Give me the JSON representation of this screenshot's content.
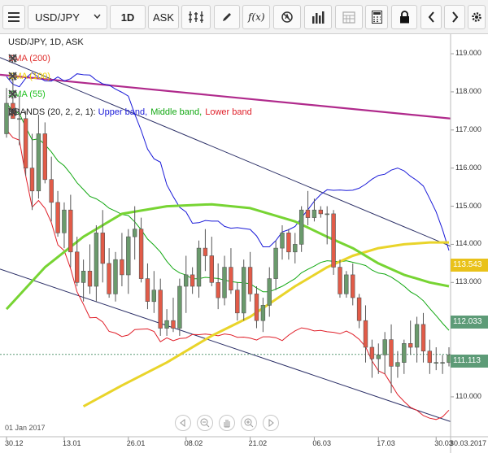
{
  "toolbar": {
    "symbol": "USD/JPY",
    "timeframe": "1D",
    "price_type": "ASK"
  },
  "chart_info": {
    "title": "USD/JPY, 1D, ASK",
    "date_label": "01 Jan 2017"
  },
  "indicators": [
    {
      "label": "SMA (200)",
      "color": "#e0312f"
    },
    {
      "label": "SMA (100)",
      "color": "#f0d000"
    },
    {
      "label": "SMA (55)",
      "color": "#22c022"
    }
  ],
  "bands": {
    "prefix": "BBANDS (20, 2, 2, 1): ",
    "upper": "Upper band,",
    "middle": "Middle band,",
    "lower": "Lower band",
    "upper_color": "#1a1ad8",
    "middle_color": "#12a812",
    "lower_color": "#e0202a"
  },
  "price_labels": {
    "sma100": "113.543",
    "bb_upper": "112.033",
    "current": "111.113"
  },
  "y_axis": [
    "119.000",
    "118.000",
    "117.000",
    "116.000",
    "115.000",
    "114.000",
    "113.000",
    "112.000",
    "111.000",
    "110.000"
  ],
  "x_axis": [
    "30.12",
    "13.01",
    "26.01",
    "08.02",
    "21.02",
    "06.03",
    "17.03",
    "30.03",
    "30.03.2017"
  ],
  "colors": {
    "bull_candle": "#6a9a6c",
    "bear_candle": "#e25b48",
    "trend_magenta": "#b02a8c",
    "channel_navy": "#2a2e66",
    "sma55": "#77d433",
    "sma100": "#e9d42a",
    "current_price": "#5d9b77"
  },
  "chart_data": {
    "type": "candlestick",
    "title": "USD/JPY, 1D, ASK",
    "ylim": [
      109.7,
      119.3
    ],
    "x_ticks": [
      "30.12",
      "13.01",
      "26.01",
      "08.02",
      "21.02",
      "06.03",
      "17.03",
      "30.03"
    ],
    "ohlc": [
      [
        116.9,
        118.1,
        116.8,
        117.7
      ],
      [
        117.7,
        118.4,
        117.3,
        117.3
      ],
      [
        117.3,
        117.9,
        116.6,
        117.3
      ],
      [
        117.3,
        117.5,
        115.8,
        116.0
      ],
      [
        116.0,
        116.9,
        114.9,
        115.4
      ],
      [
        115.4,
        117.4,
        115.2,
        116.9
      ],
      [
        116.9,
        117.2,
        115.6,
        115.7
      ],
      [
        115.7,
        116.3,
        114.6,
        115.1
      ],
      [
        115.1,
        115.4,
        114.2,
        114.3
      ],
      [
        114.3,
        115.1,
        113.9,
        114.9
      ],
      [
        114.9,
        115.3,
        113.4,
        113.8
      ],
      [
        113.8,
        114.2,
        112.9,
        113.0
      ],
      [
        113.0,
        113.6,
        112.5,
        113.3
      ],
      [
        113.3,
        114.0,
        112.7,
        112.9
      ],
      [
        112.9,
        114.5,
        112.5,
        114.3
      ],
      [
        114.3,
        114.9,
        113.0,
        113.5
      ],
      [
        113.5,
        113.9,
        112.6,
        112.7
      ],
      [
        112.7,
        113.8,
        112.5,
        113.6
      ],
      [
        113.6,
        114.3,
        112.9,
        113.2
      ],
      [
        113.2,
        114.4,
        112.7,
        114.2
      ],
      [
        114.2,
        115.0,
        113.6,
        114.4
      ],
      [
        114.4,
        114.7,
        113.0,
        113.1
      ],
      [
        113.1,
        113.5,
        112.3,
        112.5
      ],
      [
        112.5,
        113.3,
        112.2,
        112.8
      ],
      [
        112.8,
        113.1,
        111.6,
        111.8
      ],
      [
        111.8,
        112.3,
        111.6,
        112.0
      ],
      [
        112.0,
        112.6,
        111.7,
        111.8
      ],
      [
        111.8,
        113.1,
        111.6,
        112.9
      ],
      [
        112.9,
        113.7,
        112.2,
        113.2
      ],
      [
        113.2,
        113.4,
        112.7,
        112.9
      ],
      [
        112.9,
        114.1,
        112.6,
        113.9
      ],
      [
        113.9,
        114.4,
        113.3,
        113.7
      ],
      [
        113.7,
        114.2,
        112.9,
        113.0
      ],
      [
        113.0,
        113.5,
        112.3,
        112.6
      ],
      [
        112.6,
        113.7,
        112.4,
        113.4
      ],
      [
        113.4,
        113.9,
        112.7,
        112.8
      ],
      [
        112.8,
        113.0,
        112.0,
        112.2
      ],
      [
        112.2,
        113.6,
        112.0,
        113.4
      ],
      [
        113.4,
        113.8,
        112.5,
        112.7
      ],
      [
        112.7,
        112.9,
        111.8,
        112.0
      ],
      [
        112.0,
        112.6,
        111.7,
        112.4
      ],
      [
        112.4,
        113.4,
        112.1,
        113.1
      ],
      [
        113.1,
        114.1,
        112.8,
        113.9
      ],
      [
        113.9,
        114.5,
        113.6,
        114.3
      ],
      [
        114.3,
        114.4,
        113.6,
        113.8
      ],
      [
        113.8,
        114.3,
        113.5,
        114.0
      ],
      [
        114.0,
        115.0,
        113.8,
        114.9
      ],
      [
        114.9,
        115.4,
        114.5,
        114.7
      ],
      [
        114.7,
        115.2,
        114.6,
        114.9
      ],
      [
        114.9,
        115.0,
        114.7,
        114.8
      ],
      [
        114.8,
        115.0,
        114.0,
        114.8
      ],
      [
        114.8,
        114.9,
        113.2,
        113.4
      ],
      [
        113.4,
        113.6,
        112.6,
        112.7
      ],
      [
        112.7,
        113.3,
        112.6,
        113.2
      ],
      [
        113.2,
        113.5,
        112.4,
        112.6
      ],
      [
        112.6,
        112.7,
        111.8,
        112.0
      ],
      [
        112.0,
        112.4,
        110.9,
        111.3
      ],
      [
        111.3,
        111.5,
        110.5,
        111.0
      ],
      [
        111.0,
        111.4,
        110.6,
        111.1
      ],
      [
        111.1,
        111.7,
        110.6,
        111.5
      ],
      [
        111.5,
        111.9,
        110.1,
        110.8
      ],
      [
        110.8,
        111.2,
        110.5,
        110.9
      ],
      [
        110.9,
        111.5,
        110.6,
        111.4
      ],
      [
        111.4,
        112.0,
        111.1,
        111.3
      ],
      [
        111.3,
        112.1,
        110.9,
        111.9
      ],
      [
        111.9,
        112.2,
        110.9,
        111.2
      ],
      [
        111.2,
        111.5,
        110.6,
        110.9
      ],
      [
        110.9,
        111.3,
        110.7,
        110.9
      ],
      [
        110.9,
        111.1,
        110.6,
        110.9
      ],
      [
        110.9,
        111.3,
        110.8,
        111.1
      ]
    ]
  }
}
